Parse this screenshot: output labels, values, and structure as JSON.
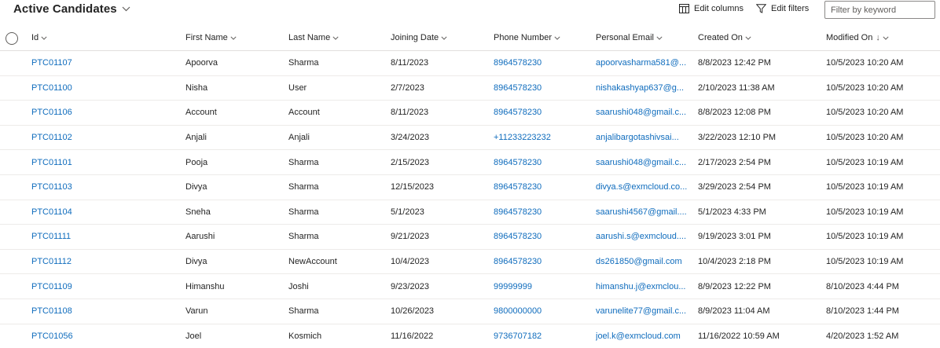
{
  "view": {
    "title": "Active Candidates",
    "commands": {
      "edit_columns": "Edit columns",
      "edit_filters": "Edit filters"
    },
    "filter_placeholder": "Filter by keyword"
  },
  "columns": [
    {
      "key": "id",
      "label": "Id"
    },
    {
      "key": "first_name",
      "label": "First Name"
    },
    {
      "key": "last_name",
      "label": "Last Name"
    },
    {
      "key": "joining_date",
      "label": "Joining Date"
    },
    {
      "key": "phone",
      "label": "Phone Number"
    },
    {
      "key": "email",
      "label": "Personal Email"
    },
    {
      "key": "created_on",
      "label": "Created On"
    },
    {
      "key": "modified_on",
      "label": "Modified On",
      "sort_indicator": "↓"
    }
  ],
  "rows": [
    {
      "id": "PTC01107",
      "first_name": "Apoorva",
      "last_name": "Sharma",
      "joining_date": "8/11/2023",
      "phone": "8964578230",
      "email": "apoorvasharma581@...",
      "created_on": "8/8/2023 12:42 PM",
      "modified_on": "10/5/2023 10:20 AM"
    },
    {
      "id": "PTC01100",
      "first_name": "Nisha",
      "last_name": "User",
      "joining_date": "2/7/2023",
      "phone": "8964578230",
      "email": "nishakashyap637@g...",
      "created_on": "2/10/2023 11:38 AM",
      "modified_on": "10/5/2023 10:20 AM"
    },
    {
      "id": "PTC01106",
      "first_name": "Account",
      "last_name": "Account",
      "joining_date": "8/11/2023",
      "phone": "8964578230",
      "email": "saarushi048@gmail.c...",
      "created_on": "8/8/2023 12:08 PM",
      "modified_on": "10/5/2023 10:20 AM"
    },
    {
      "id": "PTC01102",
      "first_name": "Anjali",
      "last_name": "Anjali",
      "joining_date": "3/24/2023",
      "phone": "+11233223232",
      "email": "anjalibargotashivsai...",
      "created_on": "3/22/2023 12:10 PM",
      "modified_on": "10/5/2023 10:20 AM"
    },
    {
      "id": "PTC01101",
      "first_name": "Pooja",
      "last_name": "Sharma",
      "joining_date": "2/15/2023",
      "phone": "8964578230",
      "email": "saarushi048@gmail.c...",
      "created_on": "2/17/2023 2:54 PM",
      "modified_on": "10/5/2023 10:19 AM"
    },
    {
      "id": "PTC01103",
      "first_name": "Divya",
      "last_name": "Sharma",
      "joining_date": "12/15/2023",
      "phone": "8964578230",
      "email": "divya.s@exmcloud.co...",
      "created_on": "3/29/2023 2:54 PM",
      "modified_on": "10/5/2023 10:19 AM"
    },
    {
      "id": "PTC01104",
      "first_name": "Sneha",
      "last_name": "Sharma",
      "joining_date": "5/1/2023",
      "phone": "8964578230",
      "email": "saarushi4567@gmail....",
      "created_on": "5/1/2023 4:33 PM",
      "modified_on": "10/5/2023 10:19 AM"
    },
    {
      "id": "PTC01111",
      "first_name": "Aarushi",
      "last_name": "Sharma",
      "joining_date": "9/21/2023",
      "phone": "8964578230",
      "email": "aarushi.s@exmcloud....",
      "created_on": "9/19/2023 3:01 PM",
      "modified_on": "10/5/2023 10:19 AM"
    },
    {
      "id": "PTC01112",
      "first_name": "Divya",
      "last_name": "NewAccount",
      "joining_date": "10/4/2023",
      "phone": "8964578230",
      "email": "ds261850@gmail.com",
      "created_on": "10/4/2023 2:18 PM",
      "modified_on": "10/5/2023 10:19 AM"
    },
    {
      "id": "PTC01109",
      "first_name": "Himanshu",
      "last_name": "Joshi",
      "joining_date": "9/23/2023",
      "phone": "99999999",
      "email": "himanshu.j@exmclou...",
      "created_on": "8/9/2023 12:22 PM",
      "modified_on": "8/10/2023 4:44 PM"
    },
    {
      "id": "PTC01108",
      "first_name": "Varun",
      "last_name": "Sharma",
      "joining_date": "10/26/2023",
      "phone": "9800000000",
      "email": "varunelite77@gmail.c...",
      "created_on": "8/9/2023 11:04 AM",
      "modified_on": "8/10/2023 1:44 PM"
    },
    {
      "id": "PTC01056",
      "first_name": "Joel",
      "last_name": "Kosmich",
      "joining_date": "11/16/2022",
      "phone": "9736707182",
      "email": "joel.k@exmcloud.com",
      "created_on": "11/16/2022 10:59 AM",
      "modified_on": "4/20/2023 1:52 AM"
    }
  ],
  "icons": {
    "title_chevron": "chevron-down-icon",
    "edit_columns": "table-columns-icon",
    "edit_filters": "filter-funnel-icon",
    "select_all": "circle-select-icon"
  },
  "colors": {
    "link": "#0f6cbd",
    "text": "#242424",
    "divider": "#edebe9"
  }
}
